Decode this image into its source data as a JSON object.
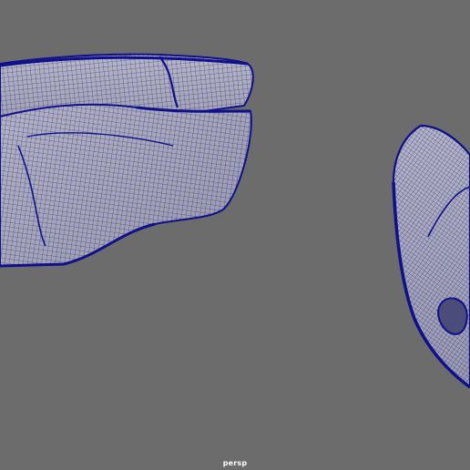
{
  "viewport": {
    "camera_label": "persp",
    "background_color": "#6c6c6c",
    "wire_color": "#10108a",
    "surface_color": "#a9a9b9"
  }
}
